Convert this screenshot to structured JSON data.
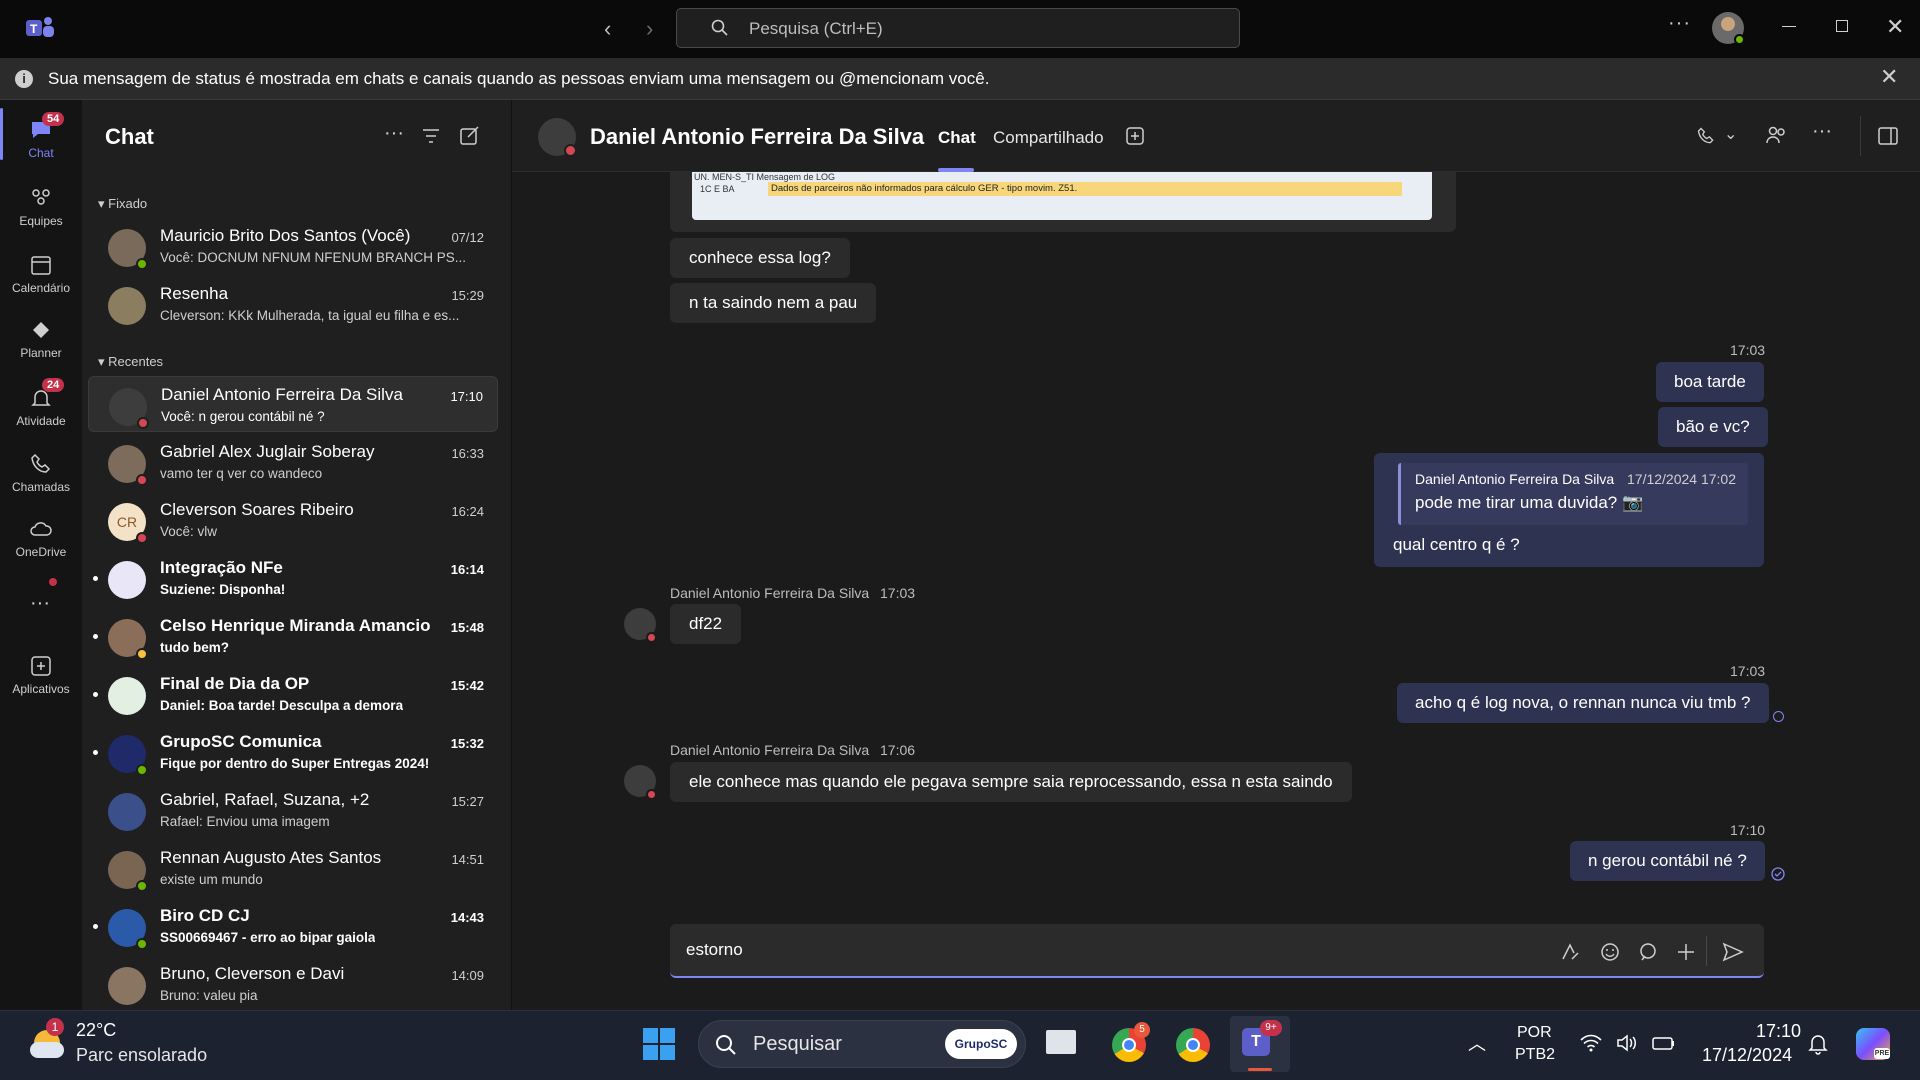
{
  "titlebar": {
    "search_placeholder": "Pesquisa (Ctrl+E)"
  },
  "banner": {
    "text": "Sua mensagem de status é mostrada em chats e canais quando as pessoas enviam uma mensagem ou @mencionam você."
  },
  "rail": {
    "items": [
      {
        "label": "Chat",
        "badge": "54"
      },
      {
        "label": "Equipes"
      },
      {
        "label": "Calendário"
      },
      {
        "label": "Planner"
      },
      {
        "label": "Atividade",
        "badge": "24"
      },
      {
        "label": "Chamadas"
      },
      {
        "label": "OneDrive"
      },
      {
        "label": "Aplicativos"
      }
    ]
  },
  "chatlist": {
    "title": "Chat",
    "section_pinned": "Fixado",
    "section_recent": "Recentes",
    "pinned": [
      {
        "name": "Mauricio Brito Dos Santos (Você)",
        "time": "07/12",
        "preview": "Você: DOCNUM NFNUM NFENUM BRANCH PS..."
      },
      {
        "name": "Resenha",
        "time": "15:29",
        "preview": "Cleverson: KKk Mulherada, ta igual eu filha e es..."
      }
    ],
    "recent": [
      {
        "name": "Daniel Antonio Ferreira Da Silva",
        "time": "17:10",
        "preview": "Você: n gerou contábil né ?"
      },
      {
        "name": "Gabriel Alex Juglair Soberay",
        "time": "16:33",
        "preview": "vamo ter q ver co wandeco"
      },
      {
        "name": "Cleverson Soares Ribeiro",
        "time": "16:24",
        "preview": "Você: vlw",
        "initials": "CR"
      },
      {
        "name": "Integração NFe",
        "time": "16:14",
        "preview": "Suziene: Disponha!"
      },
      {
        "name": "Celso Henrique Miranda Amancio",
        "time": "15:48",
        "preview": "tudo bem?"
      },
      {
        "name": "Final de Dia da OP",
        "time": "15:42",
        "preview": "Daniel: Boa tarde! Desculpa a demora"
      },
      {
        "name": "GrupoSC Comunica",
        "time": "15:32",
        "preview": "Fique por dentro do Super Entregas 2024!"
      },
      {
        "name": "Gabriel, Rafael, Suzana, +2",
        "time": "15:27",
        "preview": "Rafael: Enviou uma imagem"
      },
      {
        "name": "Rennan Augusto Ates Santos",
        "time": "14:51",
        "preview": "existe um mundo"
      },
      {
        "name": "Biro CD CJ",
        "time": "14:43",
        "preview": "SS00669467 - erro ao bipar gaiola"
      },
      {
        "name": "Bruno, Cleverson e Davi",
        "time": "14:09",
        "preview": "Bruno: valeu pia"
      }
    ]
  },
  "conversation": {
    "contact": "Daniel Antonio Ferreira Da Silva",
    "tab_chat": "Chat",
    "tab_shared": "Compartilhado",
    "image_text_1": "UN. MEN-S_TI Mensagem de LOG",
    "image_text_2": "1C E BA",
    "image_text_3": "Dados de parceiros não informados para cálculo GER - tipo movim. Z51.",
    "messages": {
      "in1": "conhece essa log?",
      "in2": "n ta saindo nem a pau",
      "out_time1": "17:03",
      "out1": "boa tarde",
      "out2": "bão e vc?",
      "quote_author": "Daniel Antonio Ferreira Da Silva",
      "quote_time": "17/12/2024 17:02",
      "quote_text": "pode me tirar uma duvida? 📷",
      "out3": "qual centro q é ?",
      "in_meta1_name": "Daniel Antonio Ferreira Da Silva",
      "in_meta1_time": "17:03",
      "in3": "df22",
      "out_time2": "17:03",
      "out4": "acho q é log nova, o rennan nunca viu tmb ?",
      "in_meta2_name": "Daniel Antonio Ferreira Da Silva",
      "in_meta2_time": "17:06",
      "in4": "ele conhece mas quando ele pegava sempre saia reprocessando, essa n esta saindo",
      "out_time3": "17:10",
      "out5": "n gerou contábil né ?"
    },
    "composer_text": "estorno"
  },
  "taskbar": {
    "weather_temp": "22°C",
    "weather_desc": "Parc ensolarado",
    "weather_badge": "1",
    "search_label": "Pesquisar",
    "search_chip": "GrupoSC",
    "chrome_badge": "5",
    "teams_badge": "9+",
    "lang_1": "POR",
    "lang_2": "PTB2",
    "clock_time": "17:10",
    "clock_date": "17/12/2024"
  },
  "colors": {
    "accent": "#7f85f5",
    "badge": "#c4314b",
    "online": "#6bb700",
    "busy": "#d74654"
  }
}
